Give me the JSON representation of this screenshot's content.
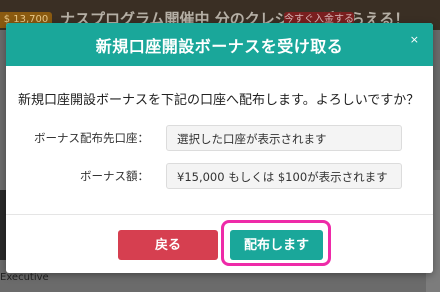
{
  "background": {
    "pill_text": "$ 13,700",
    "banner_text": "ナスプログラム開催中",
    "banner_sub": "分のクレジットがもらえる！",
    "red_pill_text": "今すぐ入金する",
    "footer_text": "Executive"
  },
  "modal": {
    "title": "新規口座開設ボーナスを受け取る",
    "close_label": "×",
    "message": "新規口座開設ボーナスを下記の口座へ配布します。よろしいですか？",
    "fields": [
      {
        "label": "ボーナス配布先口座：",
        "value": "選択した口座が表示されます"
      },
      {
        "label": "ボーナス額：",
        "value": "¥15,000 もしくは $100が表示されます"
      }
    ],
    "back_label": "戻る",
    "confirm_label": "配布します"
  },
  "colors": {
    "header": "#1aa79a",
    "confirm": "#1aa79a",
    "back": "#d63f50",
    "highlight": "#ee2aa8"
  }
}
